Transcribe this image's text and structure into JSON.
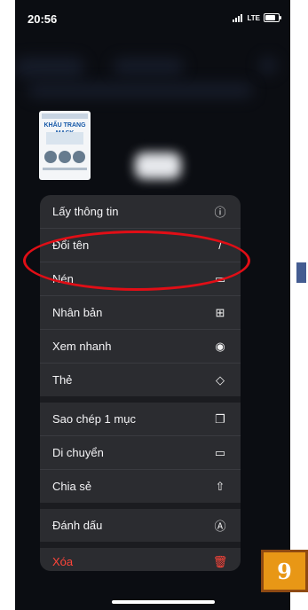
{
  "status_bar": {
    "time": "20:56",
    "network": "LTE"
  },
  "file_preview": {
    "title": "KHẨU TRANG MASK"
  },
  "menu": {
    "items": [
      {
        "label": "Lấy thông tin",
        "icon": "info-icon",
        "glyph": "ⓘ"
      },
      {
        "label": "Đổi tên",
        "icon": "pencil-icon",
        "glyph": "/"
      },
      {
        "label": "Nén",
        "icon": "archive-icon",
        "glyph": "▭"
      },
      {
        "label": "Nhân bản",
        "icon": "duplicate-icon",
        "glyph": "⊞"
      },
      {
        "label": "Xem nhanh",
        "icon": "eye-icon",
        "glyph": "◉"
      },
      {
        "label": "Thẻ",
        "icon": "tag-icon",
        "glyph": "◇"
      },
      {
        "label": "Sao chép 1 mục",
        "icon": "copy-icon",
        "glyph": "❐"
      },
      {
        "label": "Di chuyển",
        "icon": "folder-icon",
        "glyph": "▭"
      },
      {
        "label": "Chia sẻ",
        "icon": "share-icon",
        "glyph": "⇧"
      },
      {
        "label": "Đánh dấu",
        "icon": "markup-icon",
        "glyph": "Ⓐ"
      },
      {
        "label": "Xóa",
        "icon": "trash-icon",
        "glyph": "🗑"
      }
    ]
  },
  "page_badge": "9",
  "colors": {
    "menu_background": "#2b2c30",
    "destructive": "#ff453a",
    "highlight": "#e10e16",
    "badge": "#e89716"
  }
}
